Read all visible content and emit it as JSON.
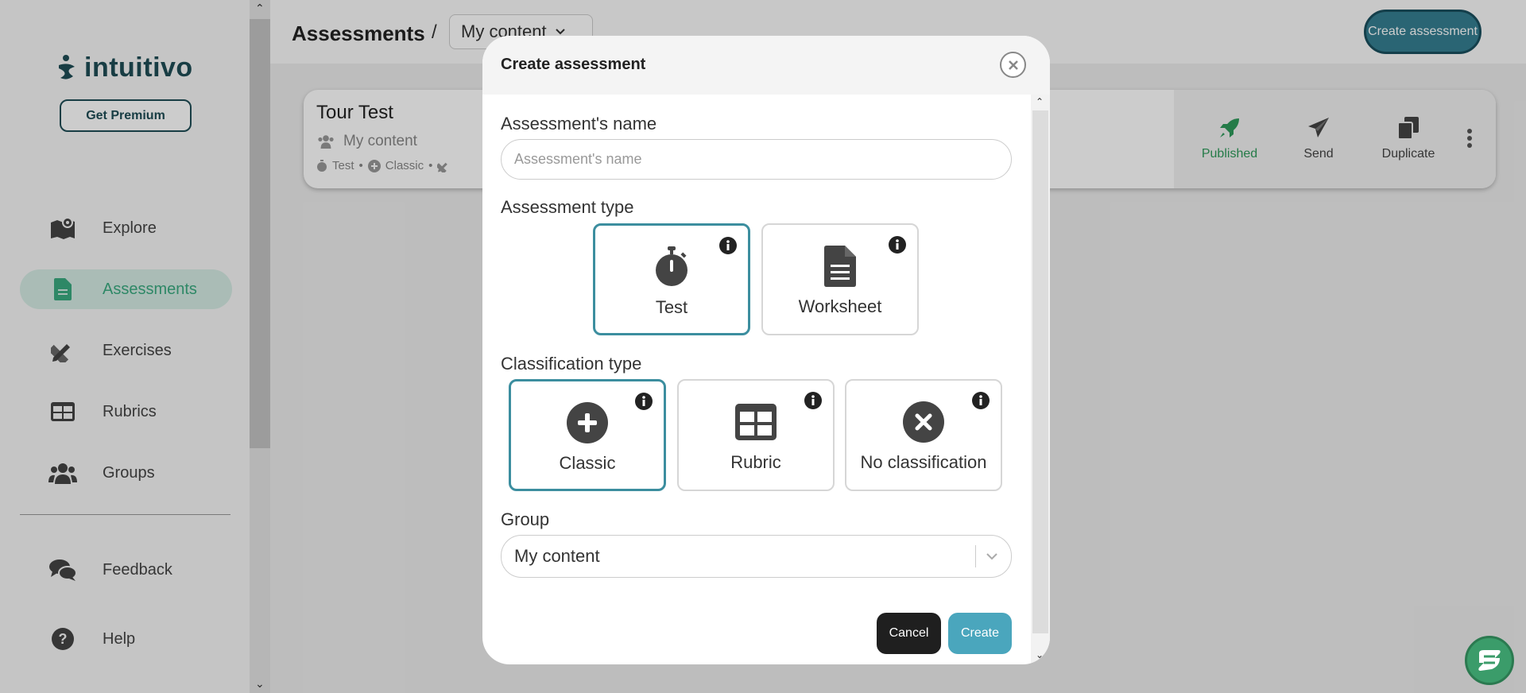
{
  "brand": {
    "name": "intuitivo",
    "premium_label": "Get Premium"
  },
  "sidebar": {
    "items": [
      {
        "label": "Explore",
        "icon": "map-icon",
        "active": false
      },
      {
        "label": "Assessments",
        "icon": "document-icon",
        "active": true
      },
      {
        "label": "Exercises",
        "icon": "pencil-ruler-icon",
        "active": false
      },
      {
        "label": "Rubrics",
        "icon": "table-icon",
        "active": false
      },
      {
        "label": "Groups",
        "icon": "users-icon",
        "active": false
      }
    ],
    "bottom_items": [
      {
        "label": "Feedback",
        "icon": "chat-bubbles-icon"
      },
      {
        "label": "Help",
        "icon": "question-circle-icon"
      }
    ]
  },
  "header": {
    "title": "Assessments",
    "separator": "/",
    "scope_select": "My content",
    "create_label": "Create assessment"
  },
  "card": {
    "title": "Tour Test",
    "group": "My content",
    "meta_type": "Test",
    "meta_classification": "Classic",
    "actions": {
      "published": "Published",
      "send": "Send",
      "duplicate": "Duplicate"
    }
  },
  "modal": {
    "title": "Create assessment",
    "name_label": "Assessment's name",
    "name_placeholder": "Assessment's name",
    "name_value": "",
    "type_label": "Assessment type",
    "types": [
      {
        "label": "Test",
        "icon": "stopwatch-icon",
        "selected": true
      },
      {
        "label": "Worksheet",
        "icon": "file-lines-icon",
        "selected": false
      }
    ],
    "classification_label": "Classification type",
    "classifications": [
      {
        "label": "Classic",
        "icon": "plus-circle-icon",
        "selected": true
      },
      {
        "label": "Rubric",
        "icon": "grid-icon",
        "selected": false
      },
      {
        "label": "No classification",
        "icon": "x-circle-icon",
        "selected": false
      }
    ],
    "group_label": "Group",
    "group_value": "My content",
    "cancel_label": "Cancel",
    "create_label": "Create"
  },
  "colors": {
    "brand_dark": "#1f4d55",
    "accent_teal": "#357f92",
    "active_green": "#3aaa80",
    "selected_border": "#3c8e9f",
    "create_button": "#4aa6bd"
  }
}
